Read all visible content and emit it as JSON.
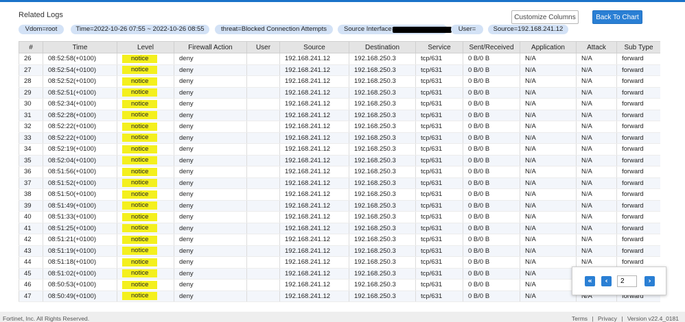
{
  "panel": {
    "title": "Related Logs",
    "customize_label": "Customize Columns",
    "back_label": "Back To Chart"
  },
  "filters": [
    "Vdom=root",
    "Time=2022-10-26 07:55 ~ 2022-10-26 08:55",
    "threat=Blocked Connection Attempts",
    "Source Interface=",
    "User=",
    "Source=192.168.241.12"
  ],
  "table": {
    "columns": [
      "#",
      "Time",
      "Level",
      "Firewall Action",
      "User",
      "Source",
      "Destination",
      "Service",
      "Sent/Received",
      "Application",
      "Attack",
      "Sub Type"
    ],
    "rows": [
      [
        "26",
        "08:52:58(+0100)",
        "notice",
        "deny",
        "",
        "192.168.241.12",
        "192.168.250.3",
        "tcp/631",
        "0 B/0 B",
        "N/A",
        "N/A",
        "forward"
      ],
      [
        "27",
        "08:52:54(+0100)",
        "notice",
        "deny",
        "",
        "192.168.241.12",
        "192.168.250.3",
        "tcp/631",
        "0 B/0 B",
        "N/A",
        "N/A",
        "forward"
      ],
      [
        "28",
        "08:52:52(+0100)",
        "notice",
        "deny",
        "",
        "192.168.241.12",
        "192.168.250.3",
        "tcp/631",
        "0 B/0 B",
        "N/A",
        "N/A",
        "forward"
      ],
      [
        "29",
        "08:52:51(+0100)",
        "notice",
        "deny",
        "",
        "192.168.241.12",
        "192.168.250.3",
        "tcp/631",
        "0 B/0 B",
        "N/A",
        "N/A",
        "forward"
      ],
      [
        "30",
        "08:52:34(+0100)",
        "notice",
        "deny",
        "",
        "192.168.241.12",
        "192.168.250.3",
        "tcp/631",
        "0 B/0 B",
        "N/A",
        "N/A",
        "forward"
      ],
      [
        "31",
        "08:52:28(+0100)",
        "notice",
        "deny",
        "",
        "192.168.241.12",
        "192.168.250.3",
        "tcp/631",
        "0 B/0 B",
        "N/A",
        "N/A",
        "forward"
      ],
      [
        "32",
        "08:52:22(+0100)",
        "notice",
        "deny",
        "",
        "192.168.241.12",
        "192.168.250.3",
        "tcp/631",
        "0 B/0 B",
        "N/A",
        "N/A",
        "forward"
      ],
      [
        "33",
        "08:52:22(+0100)",
        "notice",
        "deny",
        "",
        "192.168.241.12",
        "192.168.250.3",
        "tcp/631",
        "0 B/0 B",
        "N/A",
        "N/A",
        "forward"
      ],
      [
        "34",
        "08:52:19(+0100)",
        "notice",
        "deny",
        "",
        "192.168.241.12",
        "192.168.250.3",
        "tcp/631",
        "0 B/0 B",
        "N/A",
        "N/A",
        "forward"
      ],
      [
        "35",
        "08:52:04(+0100)",
        "notice",
        "deny",
        "",
        "192.168.241.12",
        "192.168.250.3",
        "tcp/631",
        "0 B/0 B",
        "N/A",
        "N/A",
        "forward"
      ],
      [
        "36",
        "08:51:56(+0100)",
        "notice",
        "deny",
        "",
        "192.168.241.12",
        "192.168.250.3",
        "tcp/631",
        "0 B/0 B",
        "N/A",
        "N/A",
        "forward"
      ],
      [
        "37",
        "08:51:52(+0100)",
        "notice",
        "deny",
        "",
        "192.168.241.12",
        "192.168.250.3",
        "tcp/631",
        "0 B/0 B",
        "N/A",
        "N/A",
        "forward"
      ],
      [
        "38",
        "08:51:50(+0100)",
        "notice",
        "deny",
        "",
        "192.168.241.12",
        "192.168.250.3",
        "tcp/631",
        "0 B/0 B",
        "N/A",
        "N/A",
        "forward"
      ],
      [
        "39",
        "08:51:49(+0100)",
        "notice",
        "deny",
        "",
        "192.168.241.12",
        "192.168.250.3",
        "tcp/631",
        "0 B/0 B",
        "N/A",
        "N/A",
        "forward"
      ],
      [
        "40",
        "08:51:33(+0100)",
        "notice",
        "deny",
        "",
        "192.168.241.12",
        "192.168.250.3",
        "tcp/631",
        "0 B/0 B",
        "N/A",
        "N/A",
        "forward"
      ],
      [
        "41",
        "08:51:25(+0100)",
        "notice",
        "deny",
        "",
        "192.168.241.12",
        "192.168.250.3",
        "tcp/631",
        "0 B/0 B",
        "N/A",
        "N/A",
        "forward"
      ],
      [
        "42",
        "08:51:21(+0100)",
        "notice",
        "deny",
        "",
        "192.168.241.12",
        "192.168.250.3",
        "tcp/631",
        "0 B/0 B",
        "N/A",
        "N/A",
        "forward"
      ],
      [
        "43",
        "08:51:19(+0100)",
        "notice",
        "deny",
        "",
        "192.168.241.12",
        "192.168.250.3",
        "tcp/631",
        "0 B/0 B",
        "N/A",
        "N/A",
        "forward"
      ],
      [
        "44",
        "08:51:18(+0100)",
        "notice",
        "deny",
        "",
        "192.168.241.12",
        "192.168.250.3",
        "tcp/631",
        "0 B/0 B",
        "N/A",
        "N/A",
        "forward"
      ],
      [
        "45",
        "08:51:02(+0100)",
        "notice",
        "deny",
        "",
        "192.168.241.12",
        "192.168.250.3",
        "tcp/631",
        "0 B/0 B",
        "N/A",
        "N/A",
        "forward"
      ],
      [
        "46",
        "08:50:53(+0100)",
        "notice",
        "deny",
        "",
        "192.168.241.12",
        "192.168.250.3",
        "tcp/631",
        "0 B/0 B",
        "N/A",
        "N/A",
        "forward"
      ],
      [
        "47",
        "08:50:49(+0100)",
        "notice",
        "deny",
        "",
        "192.168.241.12",
        "192.168.250.3",
        "tcp/631",
        "0 B/0 B",
        "N/A",
        "N/A",
        "forward"
      ]
    ]
  },
  "pager": {
    "first_icon": "first-page-icon",
    "prev_icon": "prev-page-icon",
    "next_icon": "next-page-icon",
    "page_value": "2"
  },
  "footer": {
    "copyright": "Fortinet, Inc. All Rights Reserved.",
    "terms": "Terms",
    "privacy": "Privacy",
    "version": "Version v22.4_0181",
    "sep": "|"
  },
  "colors": {
    "accent": "#2a7fd4",
    "chip": "#d3e2f6",
    "level_notice": "#f4f01e"
  }
}
